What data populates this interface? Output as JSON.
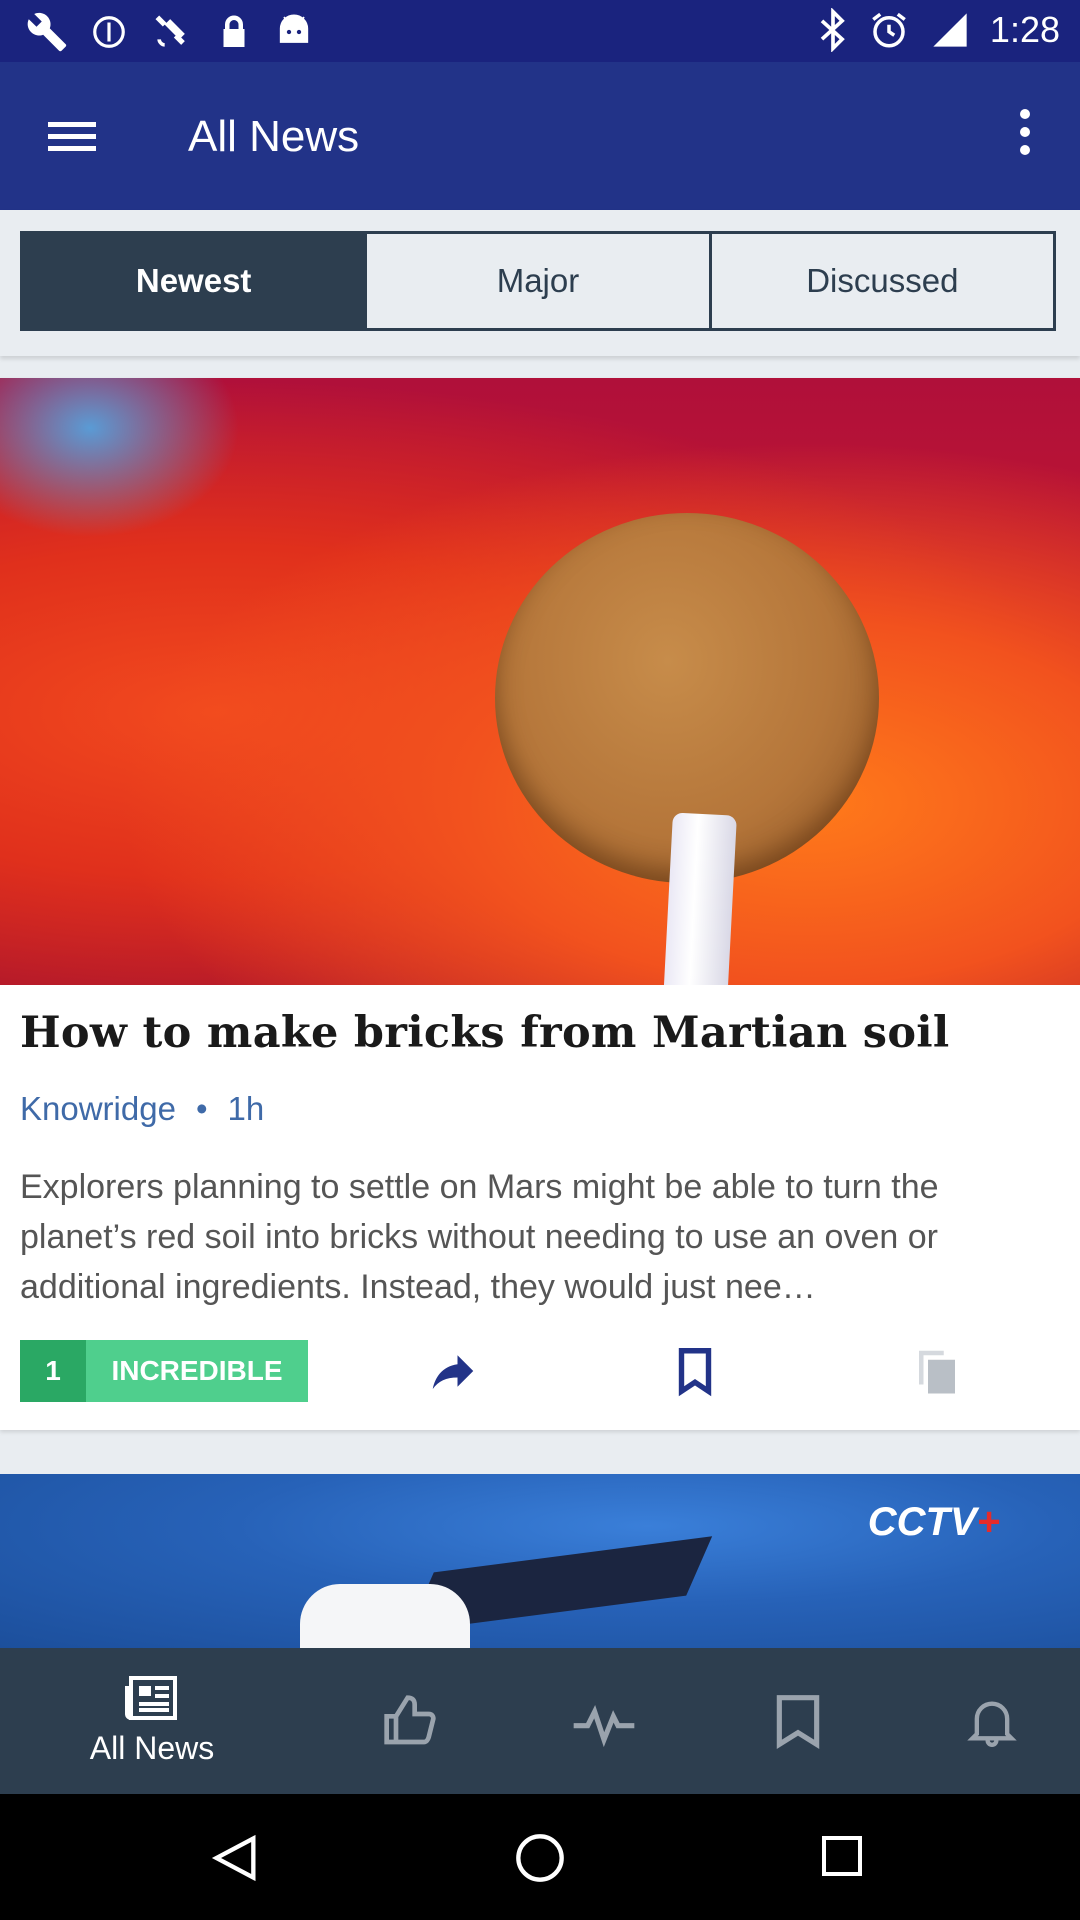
{
  "status_bar": {
    "time": "1:28",
    "left_icons": [
      "wrench-icon",
      "data-saver-icon",
      "satellite-icon",
      "lock-icon",
      "android-icon"
    ],
    "right_icons": [
      "bluetooth-icon",
      "alarm-icon",
      "signal-icon"
    ]
  },
  "app_bar": {
    "title": "All News"
  },
  "tabs": [
    {
      "label": "Newest",
      "active": true
    },
    {
      "label": "Major",
      "active": false
    },
    {
      "label": "Discussed",
      "active": false
    }
  ],
  "article": {
    "headline": "How to make bricks from Martian soil",
    "source": "Knowridge",
    "separator": "•",
    "age": "1h",
    "summary": "Explorers planning to settle on Mars might be able to turn the planet’s red soil into bricks without needing to use an oven or additional ingredients. Instead, they would just nee…",
    "reaction_count": "1",
    "reaction_label": "INCREDIBLE"
  },
  "next_article": {
    "logo_text": "CCTV",
    "logo_plus": "+"
  },
  "bottom_nav": {
    "items": [
      {
        "label": "All News",
        "icon": "newspaper-icon"
      },
      {
        "label": "",
        "icon": "thumbs-up-icon"
      },
      {
        "label": "",
        "icon": "pulse-icon"
      },
      {
        "label": "",
        "icon": "bookmark-icon"
      },
      {
        "label": "",
        "icon": "bell-icon"
      }
    ]
  },
  "colors": {
    "app_bar": "#223388",
    "status_bar": "#1a237e",
    "tab_active": "#2d3e4f",
    "source_link": "#3f6aa8",
    "reaction_count_bg": "#2aa864",
    "reaction_label_bg": "#4fcf8d",
    "action_icon": "#223388",
    "bottom_nav": "#2d3e4f"
  }
}
